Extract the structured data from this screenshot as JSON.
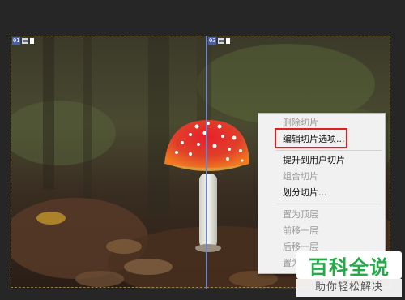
{
  "slices": [
    {
      "number": "01",
      "label": "slice-01"
    },
    {
      "number": "03",
      "label": "slice-03"
    }
  ],
  "context_menu": {
    "items": [
      {
        "label": "删除切片",
        "enabled": false
      },
      {
        "label": "编辑切片选项...",
        "enabled": true,
        "highlighted": true
      },
      {
        "label": "提升到用户切片",
        "enabled": true
      },
      {
        "label": "组合切片",
        "enabled": false
      },
      {
        "label": "划分切片...",
        "enabled": true
      },
      {
        "label": "置为顶层",
        "enabled": false
      },
      {
        "label": "前移一层",
        "enabled": false
      },
      {
        "label": "后移一层",
        "enabled": false
      },
      {
        "label": "置为",
        "enabled": false
      }
    ]
  },
  "watermark": {
    "logo_text": "百科全说",
    "subtitle": "助你轻松解决"
  },
  "colors": {
    "highlight_border": "#e02020",
    "slice_line": "#6d86c9",
    "watermark_green": "#27a84a"
  },
  "icons": [
    "slice-image-icon",
    "slice-link-icon"
  ]
}
